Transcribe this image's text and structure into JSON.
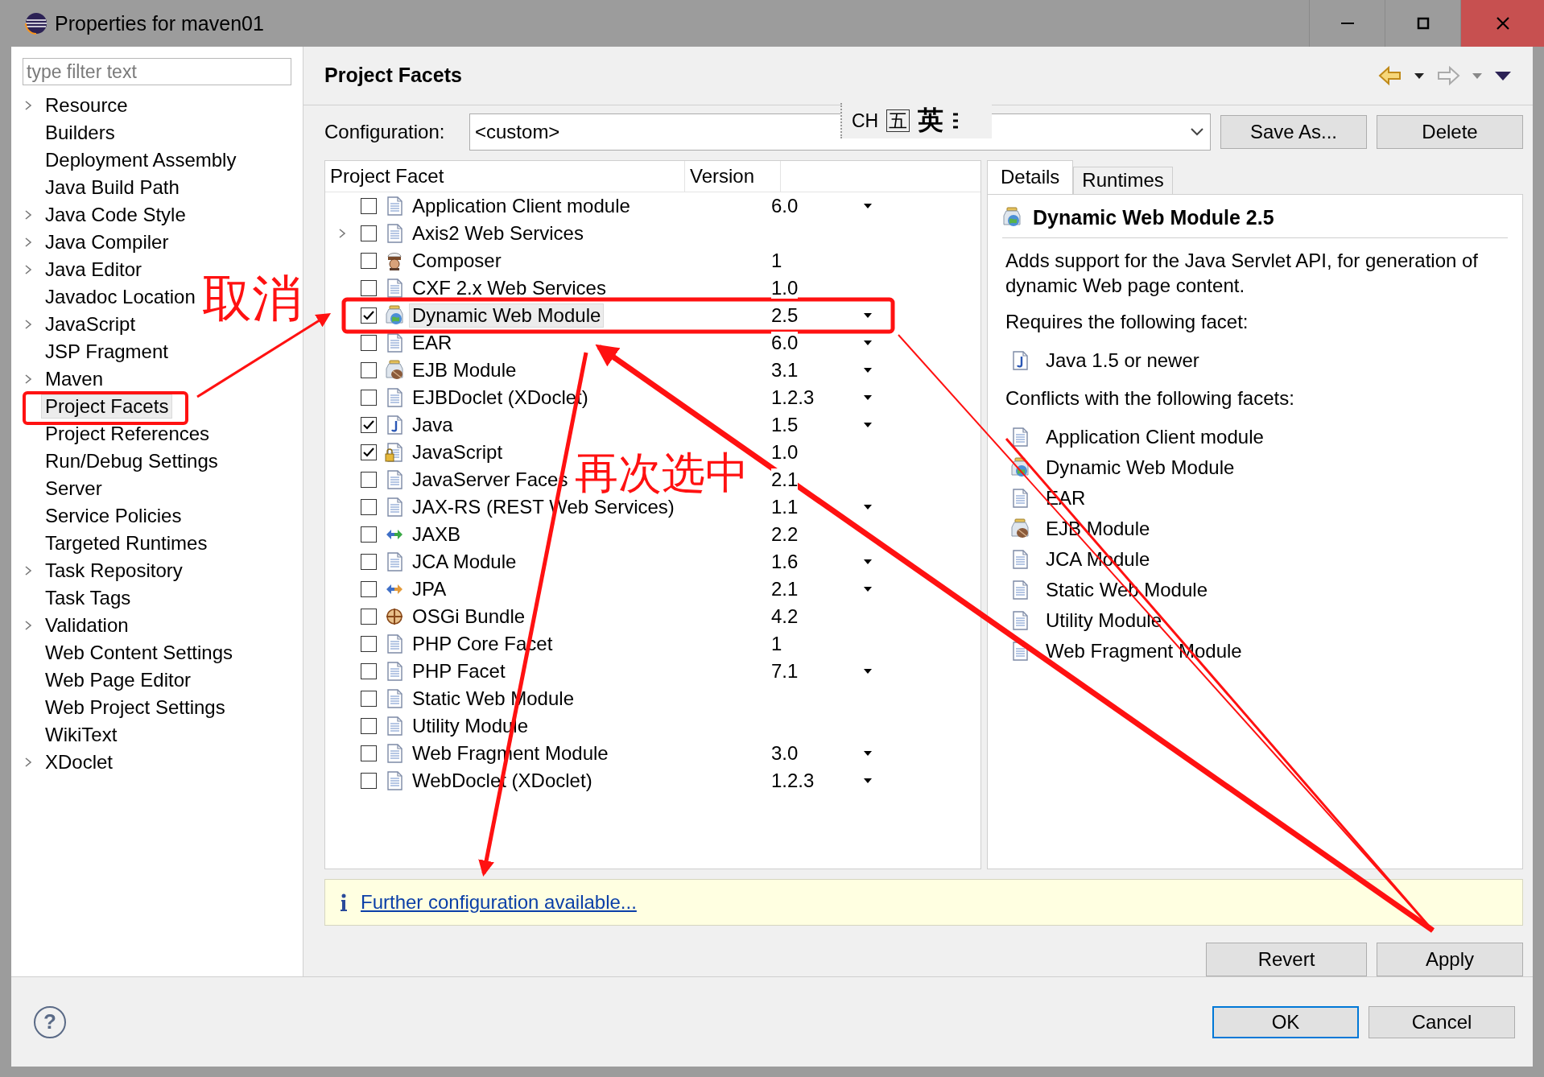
{
  "window": {
    "title": "Properties for maven01"
  },
  "filter": {
    "placeholder": "type filter text"
  },
  "sidebar": {
    "items": [
      {
        "label": "Resource",
        "collapsed": true,
        "selected": false
      },
      {
        "label": "Builders",
        "collapsed": false,
        "selected": false
      },
      {
        "label": "Deployment Assembly",
        "collapsed": false,
        "selected": false
      },
      {
        "label": "Java Build Path",
        "collapsed": false,
        "selected": false
      },
      {
        "label": "Java Code Style",
        "collapsed": true,
        "selected": false
      },
      {
        "label": "Java Compiler",
        "collapsed": true,
        "selected": false
      },
      {
        "label": "Java Editor",
        "collapsed": true,
        "selected": false
      },
      {
        "label": "Javadoc Location",
        "collapsed": false,
        "selected": false
      },
      {
        "label": "JavaScript",
        "collapsed": true,
        "selected": false
      },
      {
        "label": "JSP Fragment",
        "collapsed": false,
        "selected": false
      },
      {
        "label": "Maven",
        "collapsed": true,
        "selected": false
      },
      {
        "label": "Project Facets",
        "collapsed": false,
        "selected": true
      },
      {
        "label": "Project References",
        "collapsed": false,
        "selected": false
      },
      {
        "label": "Run/Debug Settings",
        "collapsed": false,
        "selected": false
      },
      {
        "label": "Server",
        "collapsed": false,
        "selected": false
      },
      {
        "label": "Service Policies",
        "collapsed": false,
        "selected": false
      },
      {
        "label": "Targeted Runtimes",
        "collapsed": false,
        "selected": false
      },
      {
        "label": "Task Repository",
        "collapsed": true,
        "selected": false
      },
      {
        "label": "Task Tags",
        "collapsed": false,
        "selected": false
      },
      {
        "label": "Validation",
        "collapsed": true,
        "selected": false
      },
      {
        "label": "Web Content Settings",
        "collapsed": false,
        "selected": false
      },
      {
        "label": "Web Page Editor",
        "collapsed": false,
        "selected": false
      },
      {
        "label": "Web Project Settings",
        "collapsed": false,
        "selected": false
      },
      {
        "label": "WikiText",
        "collapsed": false,
        "selected": false
      },
      {
        "label": "XDoclet",
        "collapsed": true,
        "selected": false
      }
    ]
  },
  "page": {
    "title": "Project Facets"
  },
  "ime_toolbar": {
    "items": [
      "CH",
      "五",
      "英"
    ]
  },
  "configuration": {
    "label": "Configuration:",
    "value": "<custom>",
    "buttons": [
      "Save As...",
      "Delete"
    ]
  },
  "table": {
    "columns": [
      "Project Facet",
      "Version"
    ],
    "rows": [
      {
        "kind": "document",
        "name": "Application Client module",
        "version": "6.0",
        "dropdown": true,
        "checked": false,
        "collapsed": false,
        "selected": false
      },
      {
        "kind": "document",
        "name": "Axis2 Web Services",
        "dropdown": false,
        "checked": false,
        "collapsed": true,
        "selected": false
      },
      {
        "kind": "composer",
        "name": "Composer",
        "version": "1",
        "dropdown": false,
        "checked": false,
        "collapsed": false,
        "selected": false
      },
      {
        "kind": "document",
        "name": "CXF 2.x Web Services",
        "version": "1.0",
        "dropdown": false,
        "checked": false,
        "collapsed": false,
        "selected": false
      },
      {
        "kind": "web",
        "name": "Dynamic Web Module",
        "version": "2.5",
        "dropdown": true,
        "checked": true,
        "collapsed": false,
        "selected": true
      },
      {
        "kind": "document",
        "name": "EAR",
        "version": "6.0",
        "dropdown": true,
        "checked": false,
        "collapsed": false,
        "selected": false
      },
      {
        "kind": "ejb",
        "name": "EJB Module",
        "version": "3.1",
        "dropdown": true,
        "checked": false,
        "collapsed": false,
        "selected": false
      },
      {
        "kind": "document",
        "name": "EJBDoclet (XDoclet)",
        "version": "1.2.3",
        "dropdown": true,
        "checked": false,
        "collapsed": false,
        "selected": false
      },
      {
        "kind": "java",
        "name": "Java",
        "version": "1.5",
        "dropdown": true,
        "checked": true,
        "collapsed": false,
        "selected": false
      },
      {
        "kind": "javascript",
        "name": "JavaScript",
        "version": "1.0",
        "dropdown": false,
        "checked": true,
        "collapsed": false,
        "selected": false
      },
      {
        "kind": "document",
        "name": "JavaServer Faces",
        "version": "2.1",
        "dropdown": false,
        "checked": false,
        "collapsed": false,
        "selected": false
      },
      {
        "kind": "document",
        "name": "JAX-RS (REST Web Services)",
        "version": "1.1",
        "dropdown": true,
        "checked": false,
        "collapsed": false,
        "selected": false
      },
      {
        "kind": "jaxb",
        "name": "JAXB",
        "version": "2.2",
        "dropdown": false,
        "checked": false,
        "collapsed": false,
        "selected": false
      },
      {
        "kind": "document",
        "name": "JCA Module",
        "version": "1.6",
        "dropdown": true,
        "checked": false,
        "collapsed": false,
        "selected": false
      },
      {
        "kind": "jpa",
        "name": "JPA",
        "version": "2.1",
        "dropdown": true,
        "checked": false,
        "collapsed": false,
        "selected": false
      },
      {
        "kind": "osgi",
        "name": "OSGi Bundle",
        "version": "4.2",
        "dropdown": false,
        "checked": false,
        "collapsed": false,
        "selected": false
      },
      {
        "kind": "document",
        "name": "PHP Core Facet",
        "version": "1",
        "dropdown": false,
        "checked": false,
        "collapsed": false,
        "selected": false
      },
      {
        "kind": "document",
        "name": "PHP Facet",
        "version": "7.1",
        "dropdown": true,
        "checked": false,
        "collapsed": false,
        "selected": false
      },
      {
        "kind": "document",
        "name": "Static Web Module",
        "dropdown": false,
        "checked": false,
        "collapsed": false,
        "selected": false
      },
      {
        "kind": "document",
        "name": "Utility Module",
        "dropdown": false,
        "checked": false,
        "collapsed": false,
        "selected": false
      },
      {
        "kind": "document",
        "name": "Web Fragment Module",
        "version": "3.0",
        "dropdown": true,
        "checked": false,
        "collapsed": false,
        "selected": false
      },
      {
        "kind": "document",
        "name": "WebDoclet (XDoclet)",
        "version": "1.2.3",
        "dropdown": true,
        "checked": false,
        "collapsed": false,
        "selected": false
      }
    ]
  },
  "details": {
    "tabs": [
      {
        "label": "Details",
        "selected": true
      },
      {
        "label": "Runtimes",
        "selected": false
      }
    ],
    "heading": {
      "kind": "web",
      "label": "Dynamic Web Module 2.5"
    },
    "description": "Adds support for the Java Servlet API, for generation of dynamic Web page content.",
    "requires_label": "Requires the following facet:",
    "requires": [
      {
        "kind": "java",
        "label": "Java 1.5 or newer"
      }
    ],
    "conflicts_label": "Conflicts with the following facets:",
    "conflicts": [
      {
        "kind": "document",
        "label": "Application Client module"
      },
      {
        "kind": "web",
        "label": "Dynamic Web Module"
      },
      {
        "kind": "document",
        "label": "EAR"
      },
      {
        "kind": "ejb",
        "label": "EJB Module"
      },
      {
        "kind": "document",
        "label": "JCA Module"
      },
      {
        "kind": "document",
        "label": "Static Web Module"
      },
      {
        "kind": "document",
        "label": "Utility Module"
      },
      {
        "kind": "document",
        "label": "Web Fragment Module"
      }
    ]
  },
  "info": {
    "link": "Further configuration available..."
  },
  "page_buttons": [
    "Revert",
    "Apply"
  ],
  "help": "?",
  "dialog_buttons": [
    {
      "label": "OK",
      "default": true
    },
    {
      "label": "Cancel",
      "default": false
    }
  ],
  "annotations": {
    "labels": [
      "取消",
      "再次选中"
    ]
  }
}
